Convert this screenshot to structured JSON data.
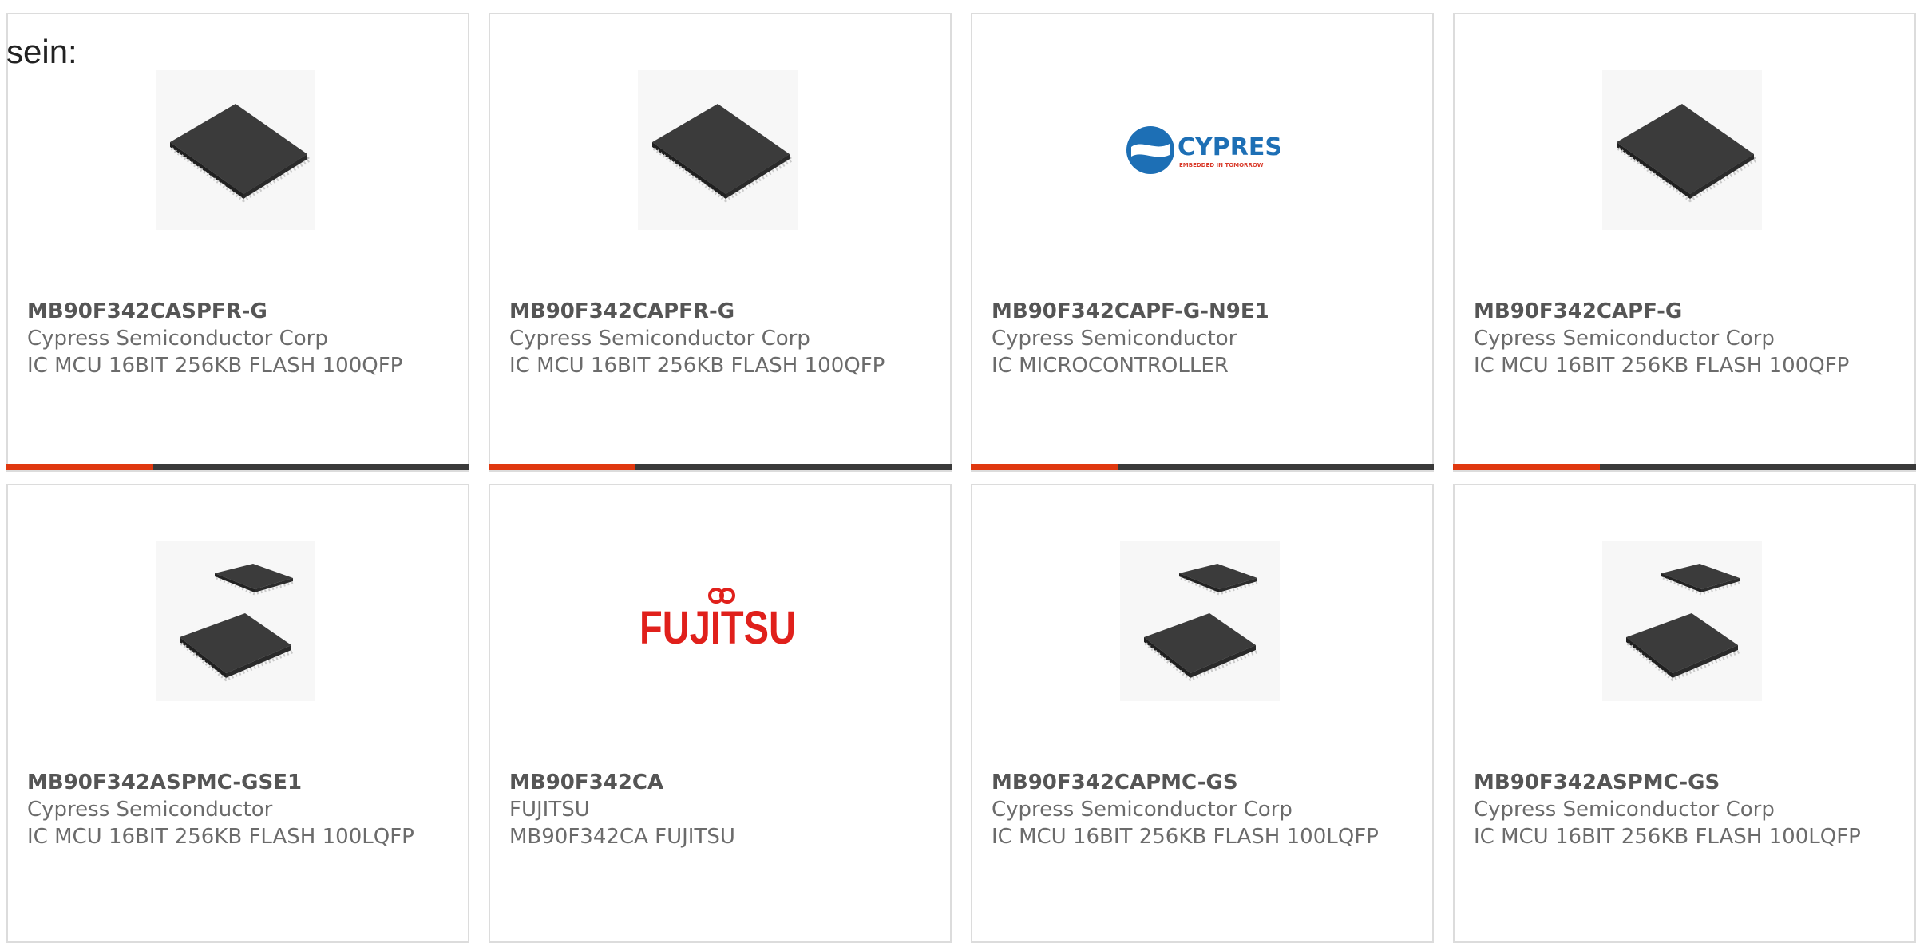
{
  "heading": "sein:",
  "colors": {
    "accent": "#e0380f",
    "bar": "#3a3a3a",
    "border": "#dcdcdc"
  },
  "products": [
    {
      "part_number": "MB90F342CASPFR-G",
      "manufacturer": "Cypress Semiconductor Corp",
      "description": "IC MCU 16BIT 256KB FLASH 100QFP",
      "image": "qfp-chip"
    },
    {
      "part_number": "MB90F342CAPFR-G",
      "manufacturer": "Cypress Semiconductor Corp",
      "description": "IC MCU 16BIT 256KB FLASH 100QFP",
      "image": "qfp-chip"
    },
    {
      "part_number": "MB90F342CAPF-G-N9E1",
      "manufacturer": "Cypress Semiconductor",
      "description": "IC MICROCONTROLLER",
      "image": "cypress-logo",
      "logo_text": "CYPRESS",
      "logo_tagline": "EMBEDDED IN TOMORROW"
    },
    {
      "part_number": "MB90F342CAPF-G",
      "manufacturer": "Cypress Semiconductor Corp",
      "description": "IC MCU 16BIT 256KB FLASH 100QFP",
      "image": "qfp-chip"
    },
    {
      "part_number": "MB90F342ASPMC-GSE1",
      "manufacturer": "Cypress Semiconductor",
      "description": "IC MCU 16BIT 256KB FLASH 100LQFP",
      "image": "lqfp-chips"
    },
    {
      "part_number": "MB90F342CA",
      "manufacturer": "FUJITSU",
      "description": "MB90F342CA FUJITSU",
      "image": "fujitsu-logo",
      "logo_text": "FUJITSU"
    },
    {
      "part_number": "MB90F342CAPMC-GS",
      "manufacturer": "Cypress Semiconductor Corp",
      "description": "IC MCU 16BIT 256KB FLASH 100LQFP",
      "image": "lqfp-chips"
    },
    {
      "part_number": "MB90F342ASPMC-GS",
      "manufacturer": "Cypress Semiconductor Corp",
      "description": "IC MCU 16BIT 256KB FLASH 100LQFP",
      "image": "lqfp-chips"
    }
  ]
}
